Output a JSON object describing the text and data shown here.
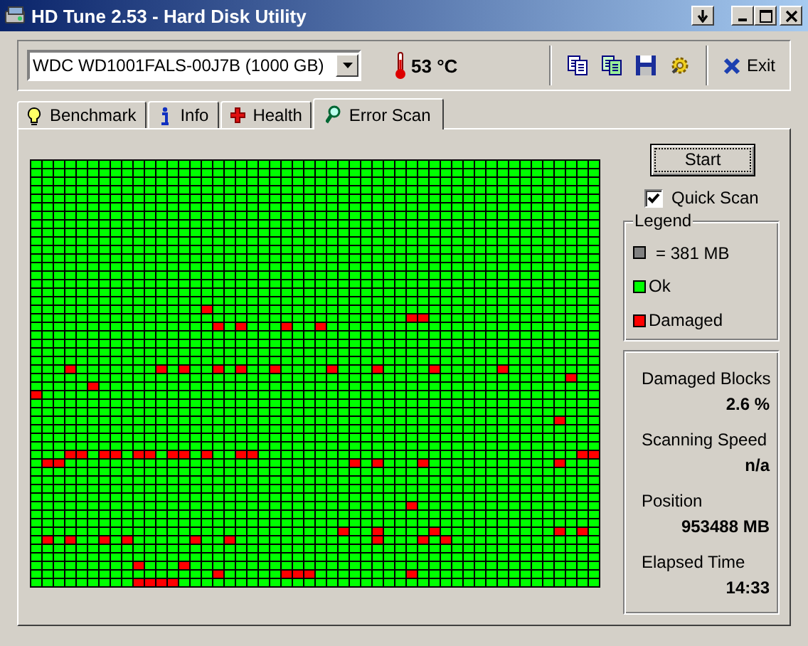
{
  "window": {
    "title": "HD Tune 2.53 - Hard Disk Utility"
  },
  "toolbar": {
    "drive": "WDC WD1001FALS-00J7B (1000 GB)",
    "temperature": "53 °C",
    "exit": "Exit"
  },
  "tabs": [
    {
      "label": "Benchmark",
      "selected": false
    },
    {
      "label": "Info",
      "selected": false
    },
    {
      "label": "Health",
      "selected": false
    },
    {
      "label": "Error Scan",
      "selected": true
    }
  ],
  "scan": {
    "start_button": "Start",
    "quick_scan": {
      "label": "Quick Scan",
      "checked": true
    }
  },
  "legend": {
    "title": "Legend",
    "items": [
      {
        "label": "= 381 MB",
        "color": "#808080"
      },
      {
        "label": "Ok",
        "color": "#00ff00"
      },
      {
        "label": "Damaged",
        "color": "#ff0000"
      }
    ]
  },
  "stats": [
    {
      "label": "Damaged Blocks",
      "value": "2.6 %"
    },
    {
      "label": "Scanning Speed",
      "value": "n/a"
    },
    {
      "label": "Position",
      "value": "953488 MB"
    },
    {
      "label": "Elapsed Time",
      "value": "14:33"
    }
  ]
}
